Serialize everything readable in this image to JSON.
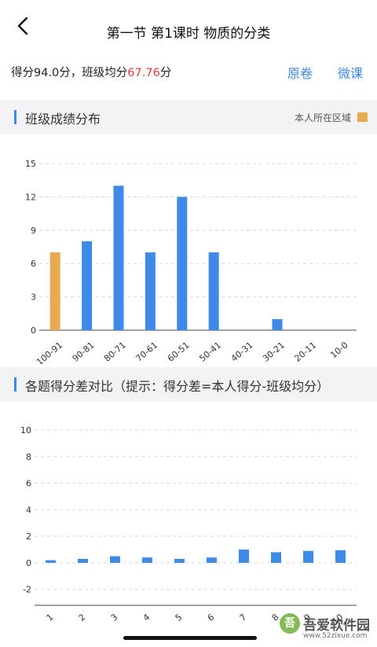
{
  "header": {
    "title": "第一节 第1课时 物质的分类",
    "back_icon": "chevron-left-icon"
  },
  "score": {
    "text_prefix": "得分94.0分，班级均分",
    "class_avg": "67.76",
    "text_suffix": "分",
    "original_link": "原卷",
    "micro_lesson_link": "微课"
  },
  "section1": {
    "title": "班级成绩分布",
    "legend_label": "本人所在区域"
  },
  "section2": {
    "title": "各题得分差对比（提示：得分差=本人得分-班级均分）"
  },
  "colors": {
    "accent": "#3d8ae8",
    "bar": "#3d8ae8",
    "highlight": "#e8aa50",
    "avg_text": "#e03c3c"
  },
  "watermark": {
    "name": "吾爱软件园",
    "url": "www.52zixue.com"
  },
  "chart_data": [
    {
      "type": "bar",
      "title": "",
      "categories": [
        "100-91",
        "90-81",
        "80-71",
        "70-61",
        "60-51",
        "50-41",
        "40-31",
        "30-21",
        "20-11",
        "10-0"
      ],
      "values": [
        7,
        8,
        13,
        7,
        12,
        7,
        0,
        1,
        0,
        0
      ],
      "highlight_index": 0,
      "yticks": [
        0,
        3,
        6,
        9,
        12,
        15
      ],
      "ylim": [
        0,
        15
      ],
      "grid": true
    },
    {
      "type": "bar",
      "title": "",
      "categories": [
        "1",
        "2",
        "3",
        "4",
        "5",
        "6",
        "7",
        "8",
        "9",
        "10"
      ],
      "values": [
        0.2,
        0.3,
        0.5,
        0.4,
        0.3,
        0.4,
        1.0,
        0.8,
        0.9,
        0.95
      ],
      "yticks": [
        -2,
        0,
        2,
        4,
        6,
        8,
        10
      ],
      "ylim": [
        -3.2,
        10
      ],
      "grid": true
    }
  ]
}
